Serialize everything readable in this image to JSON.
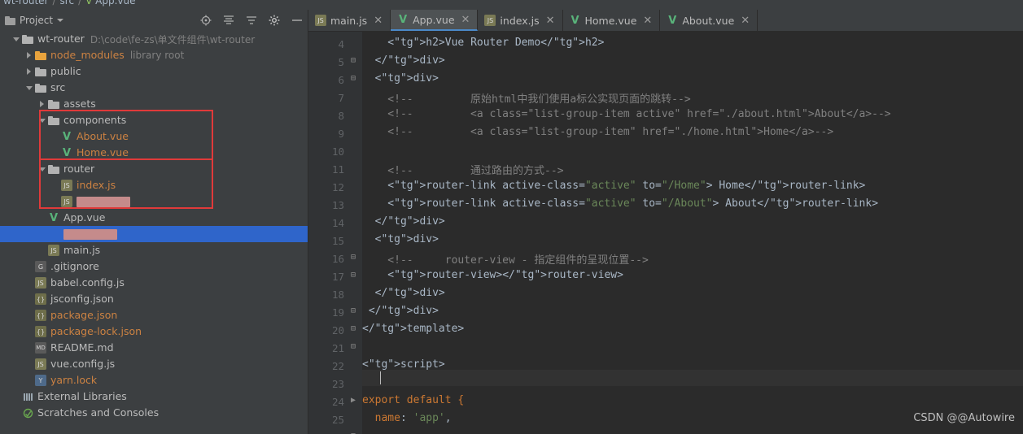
{
  "breadcrumb": {
    "project": "wt-router",
    "sep1": "/",
    "src": "src",
    "sep2": "/",
    "file": "App.vue"
  },
  "project_panel": {
    "title": "Project",
    "toolbar_icons": [
      "locate-icon",
      "collapse-all-icon",
      "expand-all-icon",
      "settings-gear-icon",
      "hide-panel-icon"
    ],
    "tree": [
      {
        "name": "wt-router",
        "path": "D:\\code\\fe-zs\\单文件组件\\wt-router",
        "type": "folder-root",
        "arrow": "down",
        "indent": 0
      },
      {
        "name": "node_modules",
        "path": "library root",
        "type": "folder-orange",
        "arrow": "right",
        "indent": 1
      },
      {
        "name": "public",
        "path": "",
        "type": "folder",
        "arrow": "right",
        "indent": 1
      },
      {
        "name": "src",
        "path": "",
        "type": "folder",
        "arrow": "down",
        "indent": 1
      },
      {
        "name": "assets",
        "path": "",
        "type": "folder",
        "arrow": "right",
        "indent": 2
      },
      {
        "name": "components",
        "path": "",
        "type": "folder",
        "arrow": "down",
        "indent": 2
      },
      {
        "name": "About.vue",
        "path": "",
        "type": "vue",
        "arrow": "none",
        "indent": 3
      },
      {
        "name": "Home.vue",
        "path": "",
        "type": "vue",
        "arrow": "none",
        "indent": 3
      },
      {
        "name": "router",
        "path": "",
        "type": "folder",
        "arrow": "down",
        "indent": 2
      },
      {
        "name": "index.js",
        "path": "",
        "type": "js",
        "arrow": "none",
        "indent": 3
      },
      {
        "name": "",
        "path": "",
        "type": "redacted",
        "arrow": "none",
        "indent": 3
      },
      {
        "name": "App.vue",
        "path": "",
        "type": "vue",
        "arrow": "none",
        "indent": 2
      },
      {
        "name": "",
        "path": "",
        "type": "redacted2",
        "arrow": "none",
        "indent": 2
      },
      {
        "name": "main.js",
        "path": "",
        "type": "js",
        "arrow": "none",
        "indent": 2
      },
      {
        "name": ".gitignore",
        "path": "",
        "type": "git",
        "arrow": "none",
        "indent": 1
      },
      {
        "name": "babel.config.js",
        "path": "",
        "type": "js",
        "arrow": "none",
        "indent": 1
      },
      {
        "name": "jsconfig.json",
        "path": "",
        "type": "json",
        "arrow": "none",
        "indent": 1
      },
      {
        "name": "package.json",
        "path": "",
        "type": "json-orange",
        "arrow": "none",
        "indent": 1
      },
      {
        "name": "package-lock.json",
        "path": "",
        "type": "json-orange",
        "arrow": "none",
        "indent": 1
      },
      {
        "name": "README.md",
        "path": "",
        "type": "md",
        "arrow": "none",
        "indent": 1
      },
      {
        "name": "vue.config.js",
        "path": "",
        "type": "js",
        "arrow": "none",
        "indent": 1
      },
      {
        "name": "yarn.lock",
        "path": "",
        "type": "lock",
        "arrow": "none",
        "indent": 1
      },
      {
        "name": "External Libraries",
        "path": "",
        "type": "libs",
        "arrow": "none",
        "indent": 0
      },
      {
        "name": "Scratches and Consoles",
        "path": "",
        "type": "scratch",
        "arrow": "none",
        "indent": 0
      }
    ]
  },
  "editor_tabs": [
    {
      "label": "main.js",
      "icon": "js-icon",
      "active": false
    },
    {
      "label": "App.vue",
      "icon": "vue-icon",
      "active": true
    },
    {
      "label": "index.js",
      "icon": "js-icon",
      "active": false
    },
    {
      "label": "Home.vue",
      "icon": "vue-icon",
      "active": false
    },
    {
      "label": "About.vue",
      "icon": "vue-icon",
      "active": false
    }
  ],
  "code": {
    "first_line_number": 4,
    "lines": [
      {
        "n": 4,
        "text": "    <h2>Vue Router Demo</h2>",
        "fold": ""
      },
      {
        "n": 5,
        "text": "  </div>",
        "fold": "-"
      },
      {
        "n": 6,
        "text": "  <div>",
        "fold": "-"
      },
      {
        "n": 7,
        "text": "    <!--         原始html中我们使用a标公实现页面的跳转-->",
        "fold": ""
      },
      {
        "n": 8,
        "text": "    <!--         <a class=\"list-group-item active\" href=\"./about.html\">About</a>-->",
        "fold": ""
      },
      {
        "n": 9,
        "text": "    <!--         <a class=\"list-group-item\" href=\"./home.html\">Home</a>-->",
        "fold": ""
      },
      {
        "n": 10,
        "text": "",
        "fold": ""
      },
      {
        "n": 11,
        "text": "    <!--         通过路由的方式-->",
        "fold": ""
      },
      {
        "n": 12,
        "text": "    <router-link active-class=\"active\" to=\"/Home\"> Home</router-link>",
        "fold": ""
      },
      {
        "n": 13,
        "text": "    <router-link active-class=\"active\" to=\"/About\"> About</router-link>",
        "fold": ""
      },
      {
        "n": 14,
        "text": "  </div>",
        "fold": "-"
      },
      {
        "n": 15,
        "text": "  <div>",
        "fold": "-"
      },
      {
        "n": 16,
        "text": "    <!--     router-view - 指定组件的呈现位置-->",
        "fold": ""
      },
      {
        "n": 17,
        "text": "    <router-view></router-view>",
        "fold": ""
      },
      {
        "n": 18,
        "text": "  </div>",
        "fold": "-"
      },
      {
        "n": 19,
        "text": " </div>",
        "fold": "-"
      },
      {
        "n": 20,
        "text": "</template>",
        "fold": "-"
      },
      {
        "n": 21,
        "text": "",
        "fold": ""
      },
      {
        "n": 22,
        "text": "<script>",
        "fold": "-"
      },
      {
        "n": 23,
        "text": "",
        "fold": ""
      },
      {
        "n": 24,
        "text": "export default {",
        "fold": "-"
      },
      {
        "n": 25,
        "text": "  name: 'app',",
        "fold": ""
      }
    ]
  },
  "watermark": "CSDN @@Autowire"
}
